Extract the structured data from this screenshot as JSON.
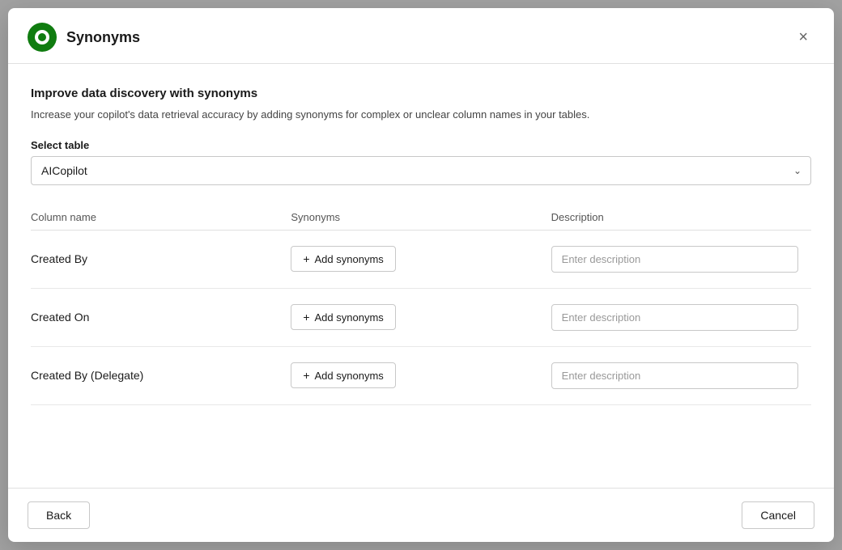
{
  "modal": {
    "title": "Synonyms",
    "close_label": "×"
  },
  "section": {
    "heading": "Improve data discovery with synonyms",
    "description": "Increase your copilot's data retrieval accuracy by adding synonyms for complex or unclear column names in your tables.",
    "select_label": "Select table",
    "select_value": "AICopilot"
  },
  "table": {
    "columns": [
      "Column name",
      "Synonyms",
      "Description"
    ],
    "rows": [
      {
        "column_name": "Created By",
        "add_synonyms_label": "+ Add synonyms",
        "description_placeholder": "Enter description"
      },
      {
        "column_name": "Created On",
        "add_synonyms_label": "+ Add synonyms",
        "description_placeholder": "Enter description"
      },
      {
        "column_name": "Created By (Delegate)",
        "add_synonyms_label": "+ Add synonyms",
        "description_placeholder": "Enter description"
      }
    ]
  },
  "footer": {
    "back_label": "Back",
    "cancel_label": "Cancel"
  },
  "icons": {
    "chevron_down": "⌄",
    "plus": "+"
  }
}
